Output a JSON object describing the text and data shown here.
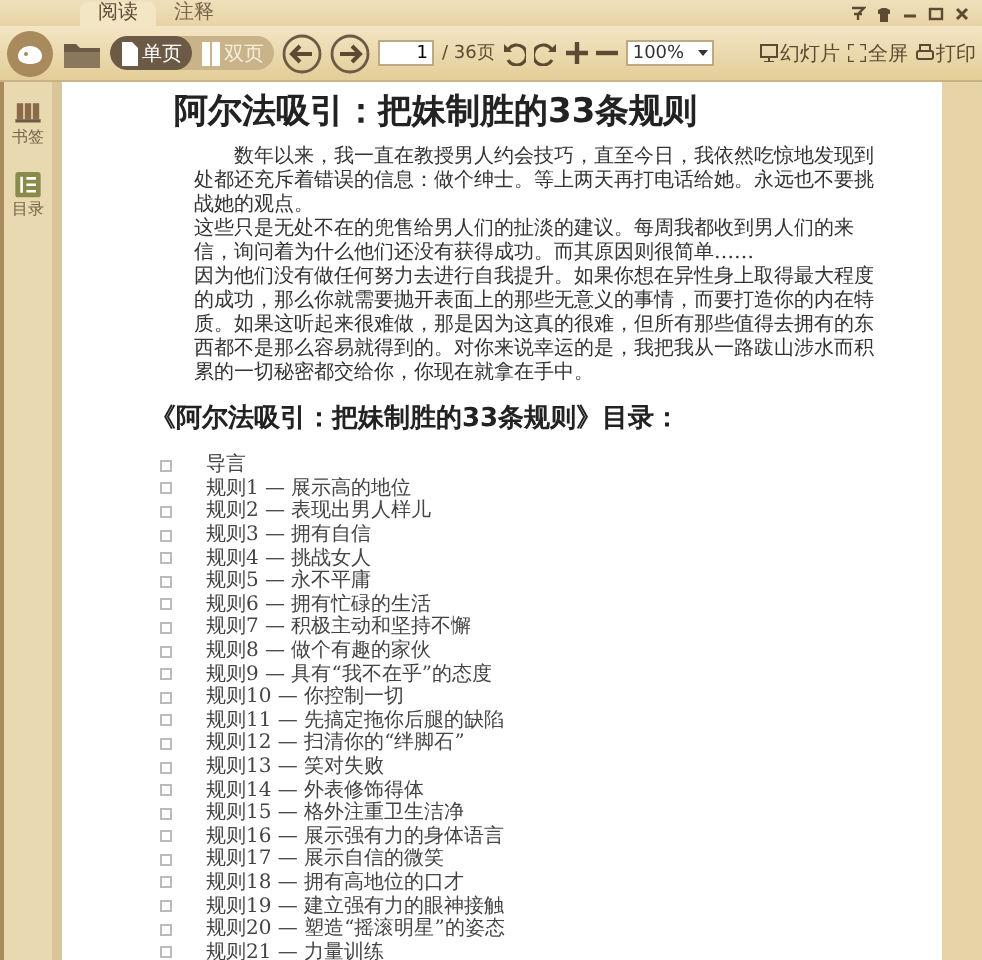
{
  "tabs": [
    {
      "label": "阅读",
      "selected": true
    },
    {
      "label": "注释",
      "selected": false
    }
  ],
  "view_modes": [
    {
      "label": "单页",
      "kind": "single",
      "selected": true
    },
    {
      "label": "双页",
      "kind": "double",
      "selected": false
    }
  ],
  "page_input": {
    "value": "1"
  },
  "page_total": "/ 36页",
  "zoom": {
    "value": "100%"
  },
  "tool_buttons": [
    {
      "label": "幻灯片",
      "kind": "slideshow"
    },
    {
      "label": "全屏",
      "kind": "fullscreen"
    },
    {
      "label": "打印",
      "kind": "print"
    }
  ],
  "sidebar": {
    "items": [
      {
        "label": "书签",
        "kind": "bookmark"
      },
      {
        "label": "目录",
        "kind": "contents"
      }
    ]
  },
  "document": {
    "title": "阿尔法吸引：把妹制胜的33条规则",
    "paragraphs": [
      "数年以来，我一直在教授男人约会技巧，直至今日，我依然吃惊地发现到处都还充斥着错误的信息：做个绅士。等上两天再打电话给她。永远也不要挑战她的观点。",
      "这些只是无处不在的兜售给男人们的扯淡的建议。每周我都收到男人们的来信，询问着为什么他们还没有获得成功。而其原因则很简单……",
      "因为他们没有做任何努力去进行自我提升。如果你想在异性身上取得最大程度的成功，那么你就需要抛开表面上的那些无意义的事情，而要打造你的内在特质。如果这听起来很难做，那是因为这真的很难，但所有那些值得去拥有的东西都不是那么容易就得到的。对你来说幸运的是，我把我从一路跋山涉水而积累的一切秘密都交给你，你现在就拿在手中。"
    ],
    "toc_heading": "《阿尔法吸引：把妹制胜的33条规则》目录：",
    "toc_items": [
      "导言",
      "规则1 — 展示高的地位",
      "规则2 — 表现出男人样儿",
      "规则3 — 拥有自信",
      "规则4 — 挑战女人",
      "规则5 — 永不平庸",
      "规则6 — 拥有忙碌的生活",
      "规则7 — 积极主动和坚持不懈",
      "规则8 — 做个有趣的家伙",
      "规则9 — 具有“我不在乎”的态度",
      "规则10 — 你控制一切",
      "规则11 — 先搞定拖你后腿的缺陷",
      "规则12 — 扫清你的“绊脚石”",
      "规则13 — 笑对失败",
      "规则14 — 外表修饰得体",
      "规则15 — 格外注重卫生洁净",
      "规则16 — 展示强有力的身体语言",
      "规则17 — 展示自信的微笑",
      "规则18 — 拥有高地位的口才",
      "规则19 — 建立强有力的眼神接触",
      "规则20 — 塑造“摇滚明星”的姿态",
      "规则21 — 力量训练"
    ]
  }
}
